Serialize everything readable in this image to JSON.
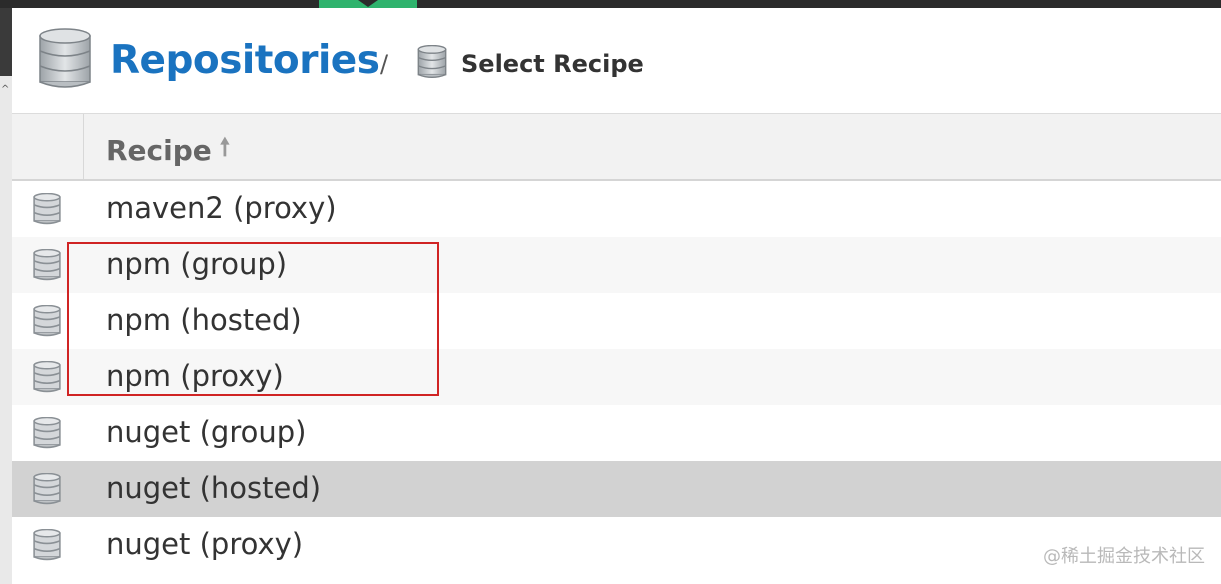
{
  "breadcrumb": {
    "title": "Repositories",
    "separator": "/",
    "current": "Select Recipe"
  },
  "grid": {
    "column_header": "Recipe",
    "sort_direction": "ascending",
    "rows": [
      {
        "label": "maven2 (proxy)"
      },
      {
        "label": "npm (group)"
      },
      {
        "label": "npm (hosted)"
      },
      {
        "label": "npm (proxy)"
      },
      {
        "label": "nuget (group)"
      },
      {
        "label": "nuget (hosted)",
        "selected": true
      },
      {
        "label": "nuget (proxy)"
      }
    ]
  },
  "annotation": {
    "highlight_color": "#d02424",
    "highlighted_rows": [
      "npm (group)",
      "npm (hosted)",
      "npm (proxy)"
    ]
  },
  "watermark": "@稀土掘金技术社区",
  "colors": {
    "accent": "#1a73c0",
    "top_tab": "#2fb36d",
    "selected_row": "#d2d2d2"
  },
  "icons": {
    "header": "database-icon",
    "crumb": "database-icon",
    "row": "database-icon",
    "sort": "arrow-up-icon"
  }
}
